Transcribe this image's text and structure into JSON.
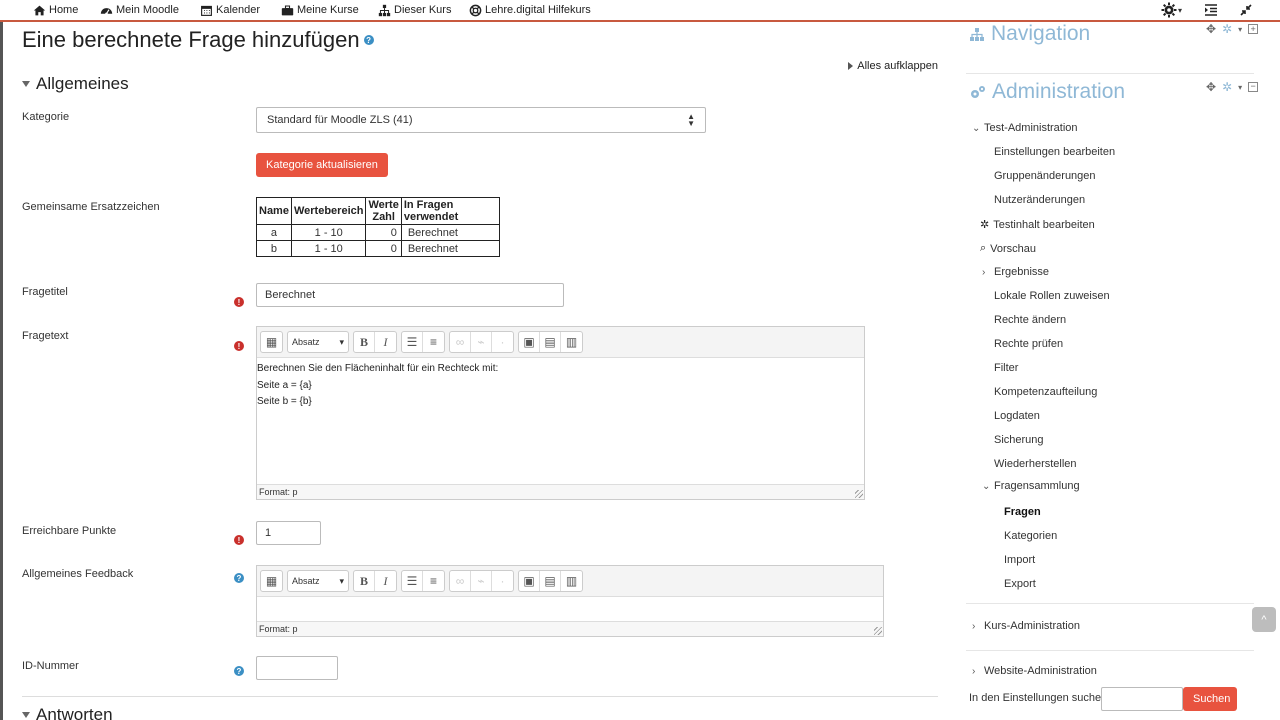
{
  "navbar": {
    "items": [
      {
        "label": "Home",
        "icon": "home-icon"
      },
      {
        "label": "Mein Moodle",
        "icon": "dashboard-icon"
      },
      {
        "label": "Kalender",
        "icon": "calendar-icon"
      },
      {
        "label": "Meine Kurse",
        "icon": "briefcase-icon"
      },
      {
        "label": "Dieser Kurs",
        "icon": "sitemap-icon"
      },
      {
        "label": "Lehre.digital Hilfekurs",
        "icon": "lifebuoy-icon"
      }
    ]
  },
  "page": {
    "title": "Eine berechnete Frage hinzufügen",
    "expand_all": "Alles aufklappen",
    "section_general": "Allgemeines",
    "section_answers": "Antworten"
  },
  "form": {
    "category_label": "Kategorie",
    "category_value": "Standard für Moodle ZLS (41)",
    "update_category_button": "Kategorie aktualisieren",
    "wildcards_label": "Gemeinsame Ersatzzeichen",
    "wildcards_table": {
      "headers": [
        "Name",
        "Wertebereich",
        "Werte Zahl",
        "In Fragen verwendet"
      ],
      "rows": [
        [
          "a",
          "1 - 10",
          "0",
          "Berechnet"
        ],
        [
          "b",
          "1 - 10",
          "0",
          "Berechnet"
        ]
      ]
    },
    "question_name_label": "Fragetitel",
    "question_name_value": "Berechnet",
    "question_text_label": "Fragetext",
    "question_text_lines": [
      "Berechnen Sie den Flächeninhalt für ein Rechteck mit:",
      "Seite a = {a}",
      "Seite b = {b}"
    ],
    "paragraph_select": "Absatz",
    "format_status": "Format: p",
    "points_label": "Erreichbare Punkte",
    "points_value": "1",
    "feedback_label": "Allgemeines Feedback",
    "id_label": "ID-Nummer",
    "id_value": ""
  },
  "sidebar": {
    "navigation_title": "Navigation",
    "administration_title": "Administration",
    "quiz_admin": "Test-Administration",
    "items": [
      "Einstellungen bearbeiten",
      "Gruppenänderungen",
      "Nutzeränderungen",
      "Testinhalt bearbeiten",
      "Vorschau",
      "Ergebnisse",
      "Lokale Rollen zuweisen",
      "Rechte ändern",
      "Rechte prüfen",
      "Filter",
      "Kompetenzaufteilung",
      "Logdaten",
      "Sicherung",
      "Wiederherstellen",
      "Fragensammlung"
    ],
    "question_bank_items": [
      "Fragen",
      "Kategorien",
      "Import",
      "Export"
    ],
    "course_admin": "Kurs-Administration",
    "site_admin": "Website-Administration",
    "search_label": "In den Einstellungen suchen",
    "search_button": "Suchen",
    "search_value": ""
  },
  "colors": {
    "accent": "#e8533f",
    "nav_border": "#c8593f",
    "block_title": "#8fb8d6",
    "required": "#c9302c",
    "help": "#3b8fc4"
  }
}
